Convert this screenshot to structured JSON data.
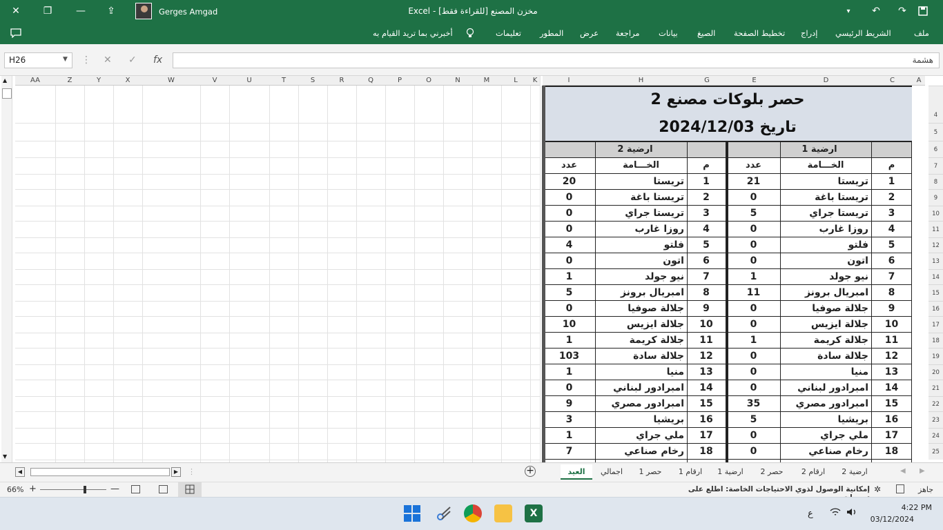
{
  "window": {
    "user": "Gerges Amgad",
    "title": "مخزن المصنع  [للقراءة فقط]  -  Excel"
  },
  "ribbon": {
    "tabs": [
      "ملف",
      "الشريط الرئيسي",
      "إدراج",
      "تخطيط الصفحة",
      "الصيغ",
      "بيانات",
      "مراجعة",
      "عرض",
      "المطور",
      "تعليمات"
    ],
    "tell_me": "أخبرني بما تريد القيام به"
  },
  "formula_bar": {
    "name_box": "H26",
    "formula": "هشمة"
  },
  "columns_left": [
    "AA",
    "Z",
    "Y",
    "X",
    "W",
    "V",
    "U",
    "T",
    "S",
    "R",
    "Q",
    "P",
    "O",
    "N",
    "M",
    "L",
    "K"
  ],
  "columns_table": [
    "I",
    "H",
    "G",
    "F",
    "E",
    "D",
    "C",
    "A"
  ],
  "row_numbers": [
    "4",
    "5",
    "6",
    "7",
    "8",
    "9",
    "10",
    "11",
    "12",
    "13",
    "14",
    "15",
    "16",
    "17",
    "18",
    "19",
    "20",
    "21",
    "22",
    "23",
    "24",
    "25"
  ],
  "table": {
    "title": "حصر بلوكات مصنع 2",
    "date_label": "تاريخ  2024/12/03",
    "section1": "ارضية 1",
    "section2": "ارضية 2",
    "col_num": "م",
    "col_material": "الخـــامة",
    "col_count": "عدد",
    "rows": [
      {
        "n": "1",
        "name": "تريستا",
        "c1": "21",
        "c2": "20"
      },
      {
        "n": "2",
        "name": "تريستا باغة",
        "c1": "0",
        "c2": "0"
      },
      {
        "n": "3",
        "name": "تريستا جراي",
        "c1": "5",
        "c2": "0"
      },
      {
        "n": "4",
        "name": "روزا غارب",
        "c1": "0",
        "c2": "0"
      },
      {
        "n": "5",
        "name": "فلتو",
        "c1": "0",
        "c2": "4"
      },
      {
        "n": "6",
        "name": "اتون",
        "c1": "0",
        "c2": "0"
      },
      {
        "n": "7",
        "name": "نيو جولد",
        "c1": "1",
        "c2": "1"
      },
      {
        "n": "8",
        "name": "امبريال برونز",
        "c1": "11",
        "c2": "5"
      },
      {
        "n": "9",
        "name": "جلالة صوفيا",
        "c1": "0",
        "c2": "0"
      },
      {
        "n": "10",
        "name": "جلالة ايزيس",
        "c1": "0",
        "c2": "10"
      },
      {
        "n": "11",
        "name": "جلالة كريمة",
        "c1": "1",
        "c2": "1"
      },
      {
        "n": "12",
        "name": "جلالة سادة",
        "c1": "0",
        "c2": "103"
      },
      {
        "n": "13",
        "name": "منيا",
        "c1": "0",
        "c2": "1"
      },
      {
        "n": "14",
        "name": "امبرادور لبناني",
        "c1": "0",
        "c2": "0"
      },
      {
        "n": "15",
        "name": "امبرادور مصري",
        "c1": "35",
        "c2": "9"
      },
      {
        "n": "16",
        "name": "بريشيا",
        "c1": "5",
        "c2": "3"
      },
      {
        "n": "17",
        "name": "ملي جراي",
        "c1": "0",
        "c2": "1"
      },
      {
        "n": "18",
        "name": "رخام صناعي",
        "c1": "0",
        "c2": "7"
      }
    ]
  },
  "sheets": [
    "العيد",
    "اجمالي",
    "حصر 1",
    "ارقام 1",
    "ارضية 1",
    "حصر 2",
    "ارقام 2",
    "ارضية 2"
  ],
  "status": {
    "ready": "جاهز",
    "accessibility": "إمكانية الوصول لذوي الاحتياجات الخاصة: اطلع على توصيات",
    "zoom": "66%"
  },
  "taskbar": {
    "time": "4:22 PM",
    "date": "03/12/2024",
    "lang": "ع"
  },
  "colors": {
    "excel_green": "#1e7145",
    "title_fill": "#d9dfe8",
    "section_fill": "#d0d0d0"
  }
}
